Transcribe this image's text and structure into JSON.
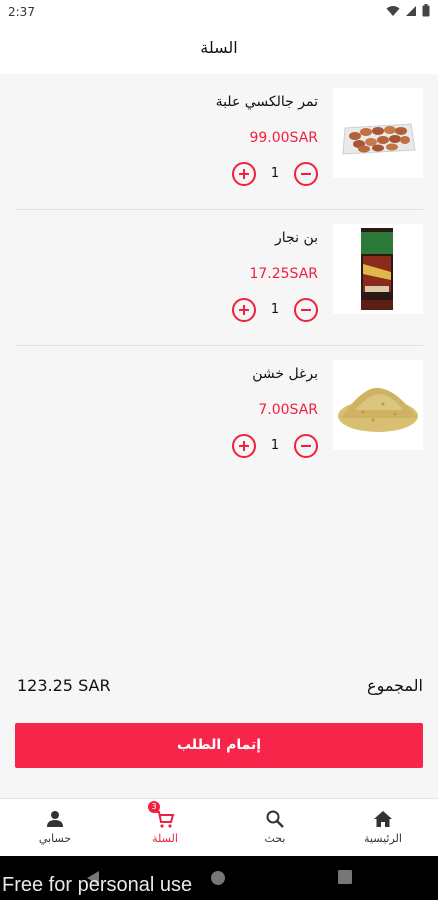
{
  "status_bar": {
    "time": "2:37",
    "icons": [
      "wifi-icon",
      "signal-icon",
      "battery-icon"
    ]
  },
  "header": {
    "title": "السلة"
  },
  "cart": {
    "items": [
      {
        "name": "تمر جالكسي علبة",
        "price": "99.00SAR",
        "quantity": "1",
        "image": "dates-tray"
      },
      {
        "name": "بن نجار",
        "price": "17.25SAR",
        "quantity": "1",
        "image": "coffee-bag"
      },
      {
        "name": "برغل خشن",
        "price": "7.00SAR",
        "quantity": "1",
        "image": "bulgur-pile"
      }
    ]
  },
  "summary": {
    "total_label": "المجموع",
    "total_amount": "123.25 SAR"
  },
  "checkout": {
    "label": "إتمام الطلب"
  },
  "bottom_nav": {
    "items": [
      {
        "label": "حسابي",
        "icon": "person-icon"
      },
      {
        "label": "السلة",
        "icon": "cart-icon",
        "badge": "3",
        "active": true
      },
      {
        "label": "بحث",
        "icon": "search-icon"
      },
      {
        "label": "الرئيسية",
        "icon": "home-icon"
      }
    ]
  },
  "watermark": "Free for personal use",
  "colors": {
    "accent": "#f0213e",
    "button": "#f8254a",
    "background": "#f6f6f6"
  }
}
